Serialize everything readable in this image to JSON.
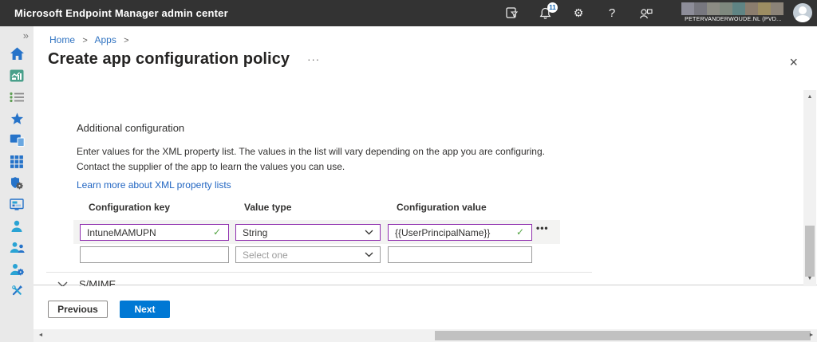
{
  "topbar": {
    "title": "Microsoft Endpoint Manager admin center",
    "notification_count": "11",
    "icons": [
      "directory-filter-icon",
      "bell-icon",
      "gear-icon",
      "help-icon",
      "feedback-icon"
    ],
    "account": {
      "name": "PETERVANDERWOUDE.NL (PVD..."
    }
  },
  "breadcrumb": {
    "items": [
      "Home",
      "Apps"
    ],
    "separator": ">"
  },
  "page": {
    "title": "Create app configuration policy",
    "more_icon": "···",
    "close_icon": "×"
  },
  "sidebar": {
    "icons": [
      "chevron-double-right",
      "home",
      "dashboard",
      "all-services",
      "favorites",
      "devices",
      "apps",
      "endpoint-security",
      "reports",
      "users",
      "groups",
      "tenant-administration",
      "troubleshooting-support"
    ],
    "expand_glyph": "»"
  },
  "section": {
    "heading": "Additional configuration",
    "description": "Enter values for the XML property list. The values in the list will vary depending on the app you are configuring. Contact the supplier of the app to learn the values you can use.",
    "learn_more": "Learn more about XML property lists"
  },
  "table": {
    "headers": [
      "Configuration key",
      "Value type",
      "Configuration value"
    ],
    "rows": [
      {
        "key": "IntuneMAMUPN",
        "value_type": "String",
        "value": "{{UserPrincipalName}}",
        "valid": true
      },
      {
        "key": "",
        "value_type_placeholder": "Select one",
        "value": ""
      }
    ],
    "check_glyph": "✓",
    "row_options_icon": "•••"
  },
  "smime": {
    "label": "S/MIME"
  },
  "footer": {
    "previous": "Previous",
    "next": "Next"
  },
  "scrollbars": {
    "up": "▲",
    "down": "▼",
    "left": "◄",
    "right": "►"
  },
  "colors": {
    "topbar_bg": "#333333",
    "accent_blue": "#0078d4",
    "link_blue": "#2266c2",
    "valid_purple": "#8f2fae",
    "check_green": "#55a545",
    "sidebar_bg": "#e9e9e9"
  }
}
